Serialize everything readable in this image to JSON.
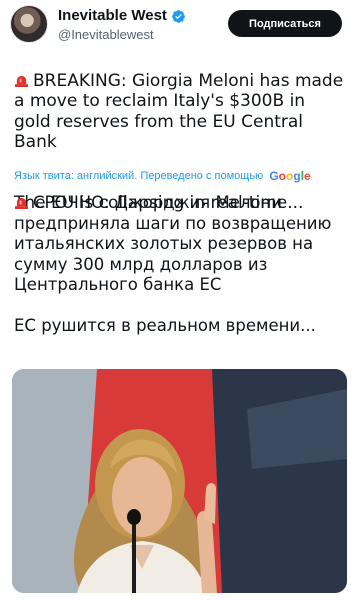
{
  "author": {
    "display_name": "Inevitable West",
    "handle": "@Inevitablewest",
    "subscribe_label": "Подписаться"
  },
  "tweet": {
    "original_line1": "BREAKING: Giorgia Meloni has made a move to reclaim Italy's $300B in gold reserves from the EU Central Bank",
    "original_line2": "The EU is collapsing in real-time...",
    "translation_note": "Язык твита: английский. Переведено с помощью",
    "translation_brand": "Google",
    "translated_line1": "СРОЧНО: Джорджия Мелони предприняла шаги по возвращению итальянских золотых резервов на сумму 300 млрд долларов из Центрального банка ЕС",
    "translated_line2": "ЕС рушится в реальном времени..."
  },
  "icons": {
    "verified": "verified-badge-icon",
    "siren": "rotating-light-icon"
  },
  "colors": {
    "accent": "#1d9bf0",
    "button_bg": "#0f1419",
    "siren_red": "#e0312a"
  }
}
